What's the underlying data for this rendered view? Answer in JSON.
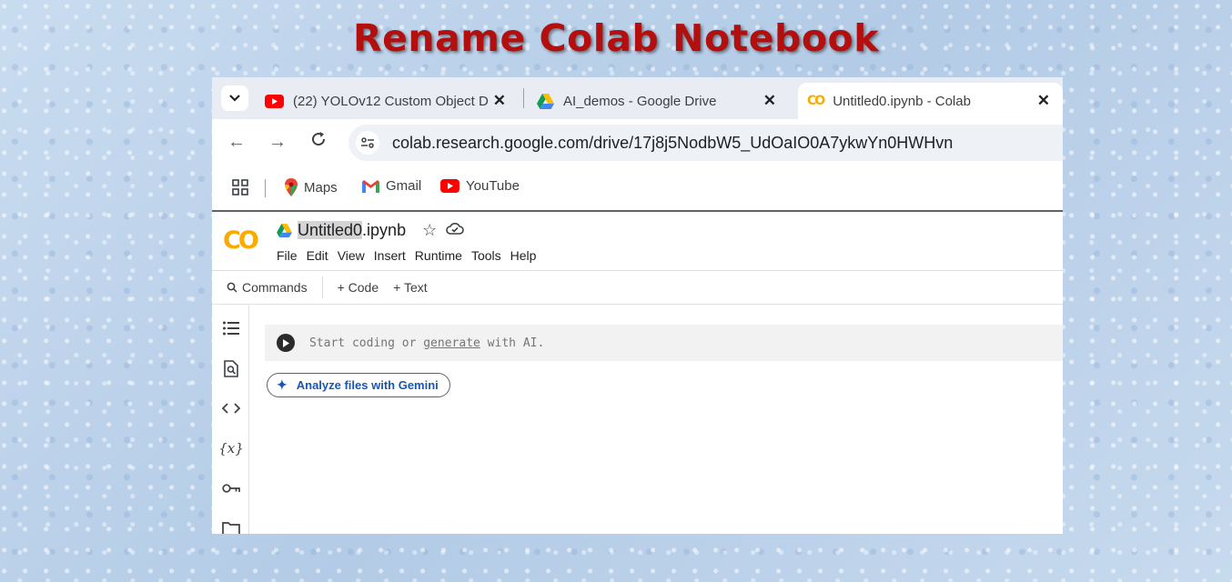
{
  "banner": {
    "title": "Rename Colab Notebook"
  },
  "browser": {
    "tabs": [
      {
        "title": "(22) YOLOv12 Custom Object D",
        "icon": "youtube-icon"
      },
      {
        "title": "AI_demos - Google Drive",
        "icon": "google-drive-icon"
      },
      {
        "title": "Untitled0.ipynb - Colab",
        "icon": "colab-icon",
        "active": true
      }
    ],
    "tab_close_glyph": "✕",
    "url": "colab.research.google.com/drive/17j8j5NodbW5_UdOaIO0A7ykwYn0HWHvn",
    "bookmarks": [
      {
        "label": "Maps",
        "icon": "maps-icon"
      },
      {
        "label": "Gmail",
        "icon": "gmail-icon"
      },
      {
        "label": "YouTube",
        "icon": "youtube-icon"
      }
    ]
  },
  "colab": {
    "logo": "CO",
    "notebook_title_selected": "Untitled0",
    "notebook_title_rest": ".ipynb",
    "menu": [
      "File",
      "Edit",
      "View",
      "Insert",
      "Runtime",
      "Tools",
      "Help"
    ],
    "toolbar": {
      "commands": "Commands",
      "code": "+ Code",
      "text": "+ Text"
    },
    "cell": {
      "placeholder_start": "Start coding or ",
      "placeholder_link": "generate",
      "placeholder_end": " with AI."
    },
    "gemini_button": "Analyze files with Gemini",
    "rail_icons": [
      "table-of-contents-icon",
      "find-icon",
      "code-snippets-icon",
      "variables-icon",
      "secrets-key-icon",
      "files-folder-icon"
    ],
    "variables_glyph": "{x}"
  },
  "colors": {
    "banner_red": "#b30f0f",
    "colab_orange": "#f9ab00",
    "gemini_blue": "#1a56b3"
  }
}
